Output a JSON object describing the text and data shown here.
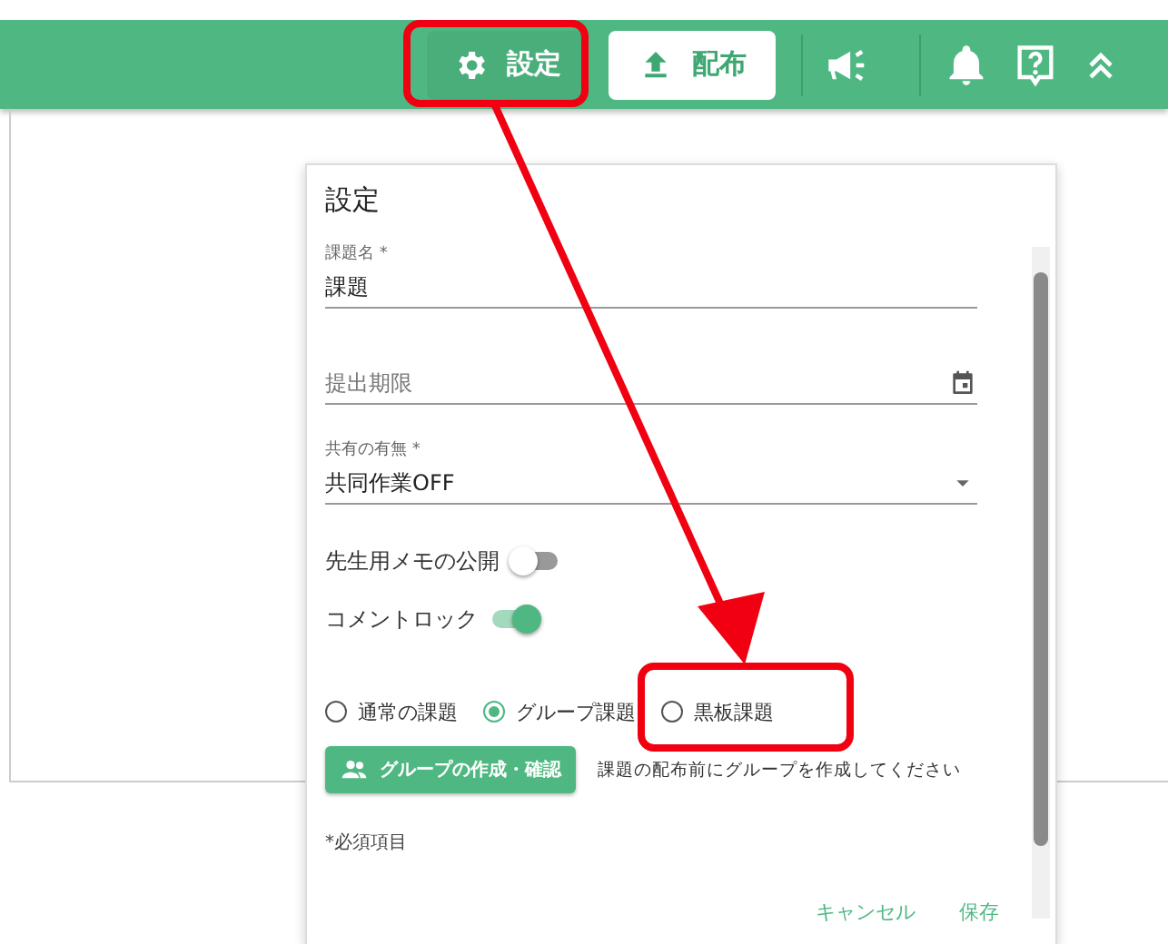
{
  "header": {
    "buttons": [
      {
        "kind": "settings",
        "label": "設定"
      },
      {
        "kind": "distribute",
        "label": "配布"
      }
    ]
  },
  "dialog": {
    "title": "設定",
    "fields": [
      {
        "kind": "text",
        "label": "課題名 *",
        "value": "課題"
      },
      {
        "kind": "date",
        "placeholder": "提出期限"
      },
      {
        "kind": "select",
        "label": "共有の有無 *",
        "value": "共同作業OFF"
      }
    ],
    "toggles": [
      {
        "label": "先生用メモの公開",
        "on": false
      },
      {
        "label": "コメントロック",
        "on": true
      }
    ],
    "radios": [
      {
        "label": "通常の課題",
        "selected": false
      },
      {
        "label": "グループ課題",
        "selected": true
      },
      {
        "label": "黒板課題",
        "selected": false
      }
    ],
    "group_button": "グループの作成・確認",
    "group_hint": "課題の配布前にグループを作成してください",
    "required_note": "*必須項目",
    "actions": [
      "キャンセル",
      "保存"
    ]
  }
}
